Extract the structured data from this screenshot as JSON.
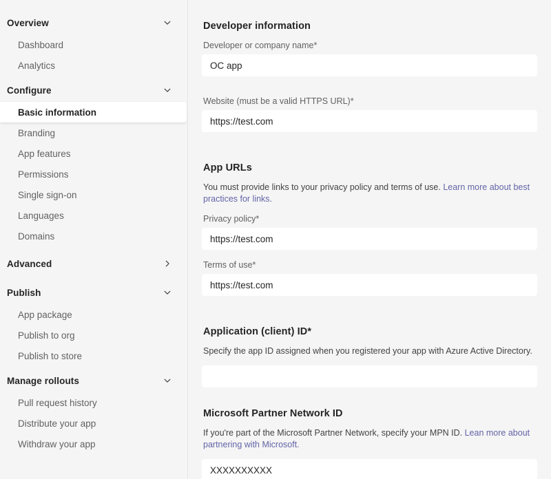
{
  "sidebar": {
    "groups": [
      {
        "header": "Overview",
        "icon": "chevron-down-icon",
        "expanded": true,
        "items": [
          {
            "label": "Dashboard",
            "selected": false
          },
          {
            "label": "Analytics",
            "selected": false
          }
        ]
      },
      {
        "header": "Configure",
        "icon": "chevron-down-icon",
        "expanded": true,
        "items": [
          {
            "label": "Basic information",
            "selected": true
          },
          {
            "label": "Branding",
            "selected": false
          },
          {
            "label": "App features",
            "selected": false
          },
          {
            "label": "Permissions",
            "selected": false
          },
          {
            "label": "Single sign-on",
            "selected": false
          },
          {
            "label": "Languages",
            "selected": false
          },
          {
            "label": "Domains",
            "selected": false
          }
        ]
      },
      {
        "header": "Advanced",
        "icon": "chevron-right-icon",
        "expanded": false,
        "items": []
      },
      {
        "header": "Publish",
        "icon": "chevron-down-icon",
        "expanded": true,
        "items": [
          {
            "label": "App package",
            "selected": false
          },
          {
            "label": "Publish to org",
            "selected": false
          },
          {
            "label": "Publish to store",
            "selected": false
          }
        ]
      },
      {
        "header": "Manage rollouts",
        "icon": "chevron-down-icon",
        "expanded": true,
        "items": [
          {
            "label": "Pull request history",
            "selected": false
          },
          {
            "label": "Distribute your app",
            "selected": false
          },
          {
            "label": "Withdraw your app",
            "selected": false
          }
        ]
      }
    ]
  },
  "main": {
    "developer_information": {
      "title": "Developer information",
      "company_name": {
        "label": "Developer or company name*",
        "value": "OC app",
        "placeholder": ""
      },
      "website": {
        "label": "Website (must be a valid HTTPS URL)*",
        "value": "https://test.com",
        "placeholder": ""
      }
    },
    "app_urls": {
      "title": "App URLs",
      "description_text": "You must provide links to your privacy policy and terms of use. ",
      "description_link": "Learn more about best practices for links.",
      "privacy_policy": {
        "label": "Privacy policy*",
        "value": "https://test.com",
        "placeholder": ""
      },
      "terms_of_use": {
        "label": "Terms of use*",
        "value": "https://test.com",
        "placeholder": ""
      }
    },
    "application_client_id": {
      "title": "Application (client) ID*",
      "description": "Specify the app ID assigned when you registered your app with Azure Active Directory.",
      "value": "",
      "placeholder": ""
    },
    "microsoft_partner_network_id": {
      "title": "Microsoft Partner Network ID",
      "description_text": "If you're part of the Microsoft Partner Network, specify your MPN ID. ",
      "description_link": "Lean more about partnering with Microsoft.",
      "value": "XXXXXXXXXX",
      "placeholder": ""
    }
  },
  "colors": {
    "link": "#6264a7",
    "page_bg": "#f5f5f5",
    "field_bg": "#ffffff",
    "text_primary": "#242424",
    "text_secondary": "#616161"
  }
}
